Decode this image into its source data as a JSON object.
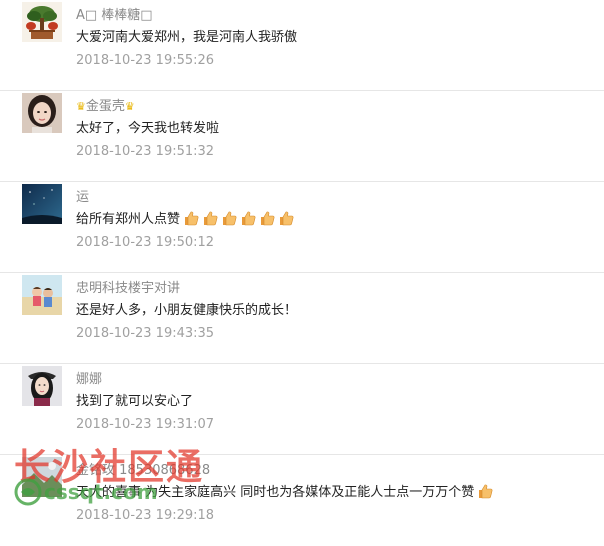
{
  "comments": [
    {
      "username": "A□ 棒棒糖□",
      "content": "大爱河南大爱郑州，我是河南人我骄傲",
      "time": "2018-10-23 19:55:26",
      "avatar_icon": "bonsai-avatar-icon"
    },
    {
      "username": "金蛋壳",
      "content": "太好了，今天我也转发啦",
      "time": "2018-10-23 19:51:32",
      "avatar_icon": "girl-portrait-avatar-icon"
    },
    {
      "username": "运",
      "content": "给所有郑州人点赞",
      "time": "2018-10-23 19:50:12",
      "avatar_icon": "night-sky-avatar-icon",
      "thumbs": 6
    },
    {
      "username": "忠明科技楼宇对讲",
      "content": "还是好人多，小朋友健康快乐的成长！",
      "time": "2018-10-23 19:43:35",
      "avatar_icon": "kids-beach-avatar-icon"
    },
    {
      "username": "娜娜",
      "content": "找到了就可以安心了",
      "time": "2018-10-23 19:31:07",
      "avatar_icon": "woman-portrait-avatar-icon"
    },
    {
      "username": "金铭玫 18530868628",
      "content": "天大的喜事 为失主家庭高兴 同时也为各媒体及正能人士点一万万个赞",
      "time": "2018-10-23 19:29:18",
      "avatar_icon": "landscape-avatar-icon",
      "thumbs": 1
    }
  ],
  "watermark": {
    "title": "长沙社区通",
    "url": "cssqt.com",
    "logo_icon": "circular-logo-icon"
  },
  "colors": {
    "username": "#8a8a8a",
    "content": "#222222",
    "timestamp": "#a0a0a0",
    "divider": "#e6e6e6",
    "crown": "#e8b400",
    "watermark_red": "#e23428",
    "watermark_green": "#40a040"
  }
}
